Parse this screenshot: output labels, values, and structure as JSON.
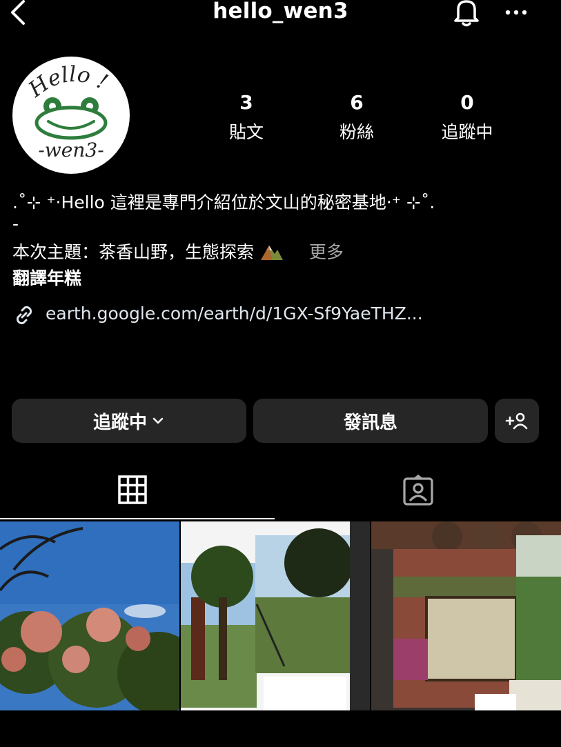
{
  "header": {
    "username": "hello_wen3",
    "back_icon": "chevron-left-icon",
    "bell_icon": "bell-icon",
    "more_icon": "more-horizontal-icon"
  },
  "avatar": {
    "logo_text_top": "Hello !",
    "logo_text_bottom": "-wen3-"
  },
  "stats": {
    "posts": {
      "value": "3",
      "label": "貼文"
    },
    "followers": {
      "value": "6",
      "label": "粉絲"
    },
    "following": {
      "value": "0",
      "label": "追蹤中"
    }
  },
  "bio": {
    "line1": ".˚⊹ ⁺‧Hello 這裡是專門介紹位於文山的秘密基地‧⁺ ⊹˚.",
    "line2": "-",
    "line3": "本次主題：茶香山野，生態探索",
    "more": "更多",
    "translate": "翻譯年糕",
    "link": "earth.google.com/earth/d/1GX-Sf9YaeTHZ..."
  },
  "buttons": {
    "following": "追蹤中",
    "message": "發訊息",
    "add_user_icon": "add-person-icon"
  },
  "tabs": {
    "grid_icon": "grid-icon",
    "tagged_icon": "tagged-person-icon"
  },
  "colors": {
    "background": "#000000",
    "button": "#262626",
    "secondary_text": "#a8a8a8",
    "frog_green": "#2e7d3c"
  }
}
